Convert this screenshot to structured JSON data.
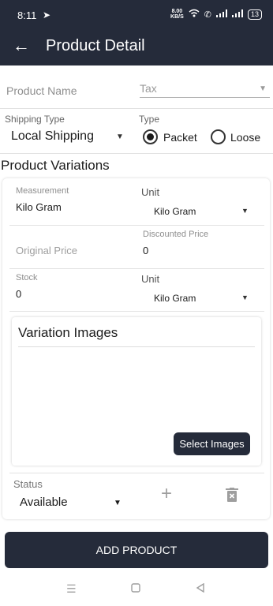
{
  "status_bar": {
    "time": "8:11",
    "speed_value": "8.00",
    "speed_unit": "KB/S",
    "battery": "13"
  },
  "app_bar": {
    "title": "Product Detail"
  },
  "product_name": {
    "label": "Product Name"
  },
  "tax": {
    "placeholder": "Tax"
  },
  "shipping": {
    "label": "Shipping Type",
    "value": "Local Shipping"
  },
  "type": {
    "label": "Type",
    "options": [
      {
        "label": "Packet",
        "selected": true
      },
      {
        "label": "Loose",
        "selected": false
      }
    ]
  },
  "variations": {
    "title": "Product Variations",
    "measurement": {
      "label": "Measurement",
      "value": "Kilo Gram"
    },
    "unit1": {
      "label": "Unit",
      "value": "Kilo Gram"
    },
    "original_price": {
      "label": "Original Price"
    },
    "discounted_price": {
      "label": "Discounted Price",
      "value": "0"
    },
    "stock": {
      "label": "Stock",
      "value": "0"
    },
    "unit2": {
      "label": "Unit",
      "value": "Kilo Gram"
    },
    "images": {
      "title": "Variation Images",
      "button": "Select Images"
    },
    "status": {
      "label": "Status",
      "value": "Available"
    }
  },
  "add_button": "ADD PRODUCT",
  "colors": {
    "primary": "#252b3a",
    "muted": "#9e9e9e"
  },
  "icons": [
    "back-arrow-icon",
    "telegram-icon",
    "wifi-icon",
    "call-icon",
    "signal-icon",
    "battery-icon",
    "dropdown-arrow-icon",
    "plus-icon",
    "trash-icon",
    "nav-menu-icon",
    "nav-home-icon",
    "nav-back-icon"
  ]
}
